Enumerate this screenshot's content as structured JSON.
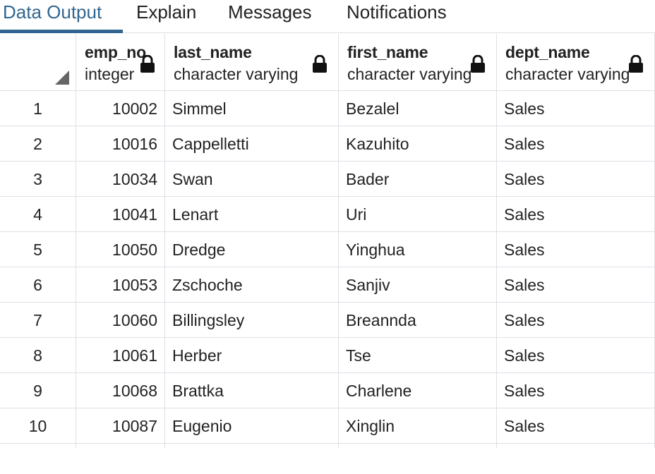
{
  "tabs": [
    {
      "label": "Data Output",
      "active": true
    },
    {
      "label": "Explain",
      "active": false
    },
    {
      "label": "Messages",
      "active": false
    },
    {
      "label": "Notifications",
      "active": false
    }
  ],
  "columns": [
    {
      "name": "emp_no",
      "type": "integer"
    },
    {
      "name": "last_name",
      "type": "character varying"
    },
    {
      "name": "first_name",
      "type": "character varying"
    },
    {
      "name": "dept_name",
      "type": "character varying"
    }
  ],
  "rows": [
    {
      "n": "1",
      "emp_no": "10002",
      "last_name": "Simmel",
      "first_name": "Bezalel",
      "dept_name": "Sales"
    },
    {
      "n": "2",
      "emp_no": "10016",
      "last_name": "Cappelletti",
      "first_name": "Kazuhito",
      "dept_name": "Sales"
    },
    {
      "n": "3",
      "emp_no": "10034",
      "last_name": "Swan",
      "first_name": "Bader",
      "dept_name": "Sales"
    },
    {
      "n": "4",
      "emp_no": "10041",
      "last_name": "Lenart",
      "first_name": "Uri",
      "dept_name": "Sales"
    },
    {
      "n": "5",
      "emp_no": "10050",
      "last_name": "Dredge",
      "first_name": "Yinghua",
      "dept_name": "Sales"
    },
    {
      "n": "6",
      "emp_no": "10053",
      "last_name": "Zschoche",
      "first_name": "Sanjiv",
      "dept_name": "Sales"
    },
    {
      "n": "7",
      "emp_no": "10060",
      "last_name": "Billingsley",
      "first_name": "Breannda",
      "dept_name": "Sales"
    },
    {
      "n": "8",
      "emp_no": "10061",
      "last_name": "Herber",
      "first_name": "Tse",
      "dept_name": "Sales"
    },
    {
      "n": "9",
      "emp_no": "10068",
      "last_name": "Brattka",
      "first_name": "Charlene",
      "dept_name": "Sales"
    },
    {
      "n": "10",
      "emp_no": "10087",
      "last_name": "Eugenio",
      "first_name": "Xinglin",
      "dept_name": "Sales"
    }
  ],
  "colors": {
    "accent": "#326690",
    "grid_line": "#dde0e6"
  },
  "icons": {
    "column_lock": "lock-icon",
    "select_all": "select-all-corner-icon"
  }
}
